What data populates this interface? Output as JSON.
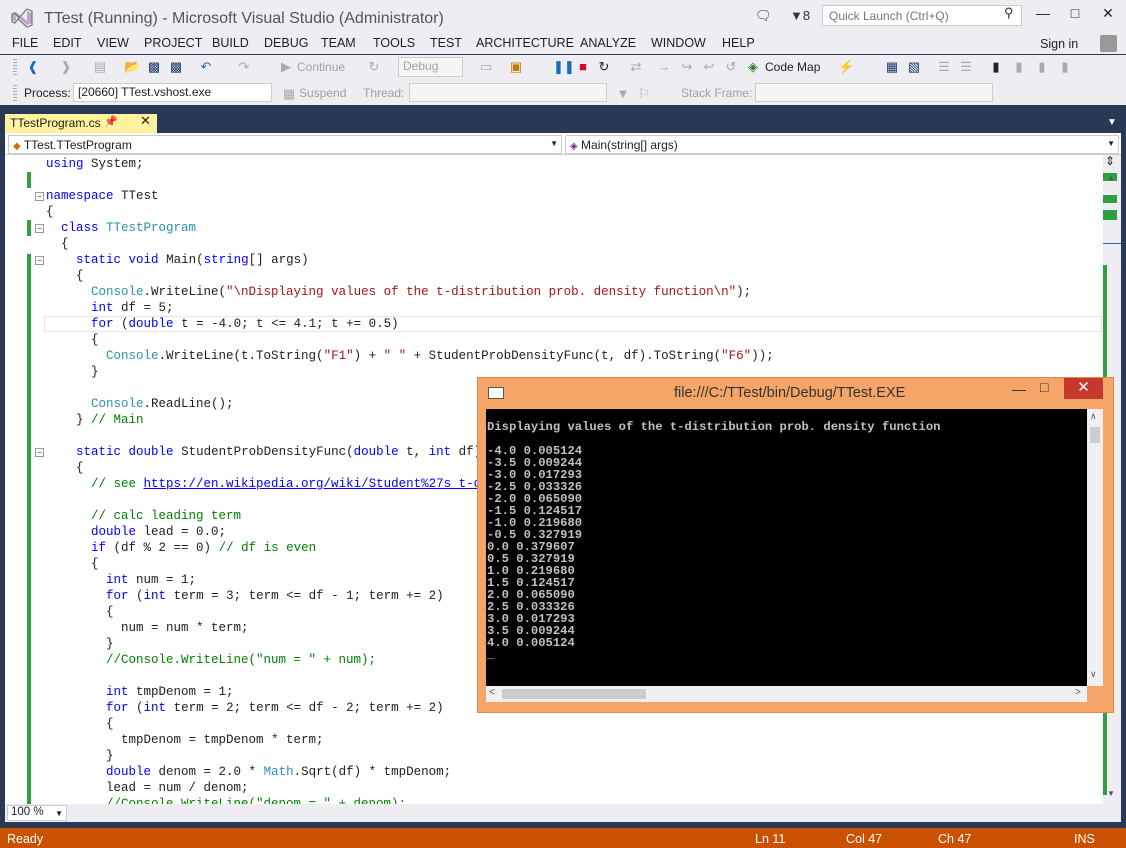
{
  "window": {
    "title": "TTest (Running) - Microsoft Visual Studio (Administrator)",
    "notification_count": "8",
    "quick_launch_placeholder": "Quick Launch (Ctrl+Q)"
  },
  "menu": [
    "FILE",
    "EDIT",
    "VIEW",
    "PROJECT",
    "BUILD",
    "DEBUG",
    "TEAM",
    "TOOLS",
    "TEST",
    "ARCHITECTURE",
    "ANALYZE",
    "WINDOW",
    "HELP"
  ],
  "signin": "Sign in",
  "toolbar": {
    "continue_label": "Continue",
    "config_value": "Debug",
    "codemap_label": "Code Map"
  },
  "debugbar": {
    "process_label": "Process:",
    "process_value": "[20660] TTest.vshost.exe",
    "suspend_label": "Suspend",
    "thread_label": "Thread:",
    "stackframe_label": "Stack Frame:"
  },
  "tab": {
    "label": "TTestProgram.cs"
  },
  "nav": {
    "class_value": "TTest.TTestProgram",
    "member_value": "Main(string[] args)"
  },
  "code": [
    "using System;",
    "",
    "namespace TTest",
    "{",
    "  class TTestProgram",
    "  {",
    "    static void Main(string[] args)",
    "    {",
    "      Console.WriteLine(\"\\nDisplaying values of the t-distribution prob. density function\\n\");",
    "      int df = 5;",
    "      for (double t = -4.0; t <= 4.1; t += 0.5)",
    "      {",
    "        Console.WriteLine(t.ToString(\"F1\") + \" \" + StudentProbDensityFunc(t, df).ToString(\"F6\"));",
    "      }",
    "",
    "      Console.ReadLine();",
    "    } // Main",
    "",
    "    static double StudentProbDensityFunc(double t, int df)",
    "    {",
    "      // see https://en.wikipedia.org/wiki/Student%27s_t-distr",
    "",
    "      // calc leading term",
    "      double lead = 0.0;",
    "      if (df % 2 == 0) // df is even",
    "      {",
    "        int num = 1;",
    "        for (int term = 3; term <= df - 1; term += 2)",
    "        {",
    "          num = num * term;",
    "        }",
    "        //Console.WriteLine(\"num = \" + num);",
    "",
    "        int tmpDenom = 1;",
    "        for (int term = 2; term <= df - 2; term += 2)",
    "        {",
    "          tmpDenom = tmpDenom * term;",
    "        }",
    "        double denom = 2.0 * Math.Sqrt(df) * tmpDenom;",
    "        lead = num / denom;",
    "        //Console.WriteLine(\"denom = \" + denom);"
  ],
  "console": {
    "title": "file:///C:/TTest/bin/Debug/TTest.EXE",
    "lines": [
      "Displaying values of the t-distribution prob. density function",
      "",
      "-4.0 0.005124",
      "-3.5 0.009244",
      "-3.0 0.017293",
      "-2.5 0.033326",
      "-2.0 0.065090",
      "-1.5 0.124517",
      "-1.0 0.219680",
      "-0.5 0.327919",
      "0.0 0.379607",
      "0.5 0.327919",
      "1.0 0.219680",
      "1.5 0.124517",
      "2.0 0.065090",
      "2.5 0.033326",
      "3.0 0.017293",
      "3.5 0.009244",
      "4.0 0.005124",
      "_"
    ]
  },
  "zoom": "100 %",
  "status": {
    "state": "Ready",
    "ln": "Ln 11",
    "col": "Col 47",
    "ch": "Ch 47",
    "mode": "INS"
  },
  "colors": {
    "status_bar": "#ca5100",
    "tab_active": "#fff29d",
    "console_frame": "#f5a567",
    "chrome": "#293955"
  }
}
